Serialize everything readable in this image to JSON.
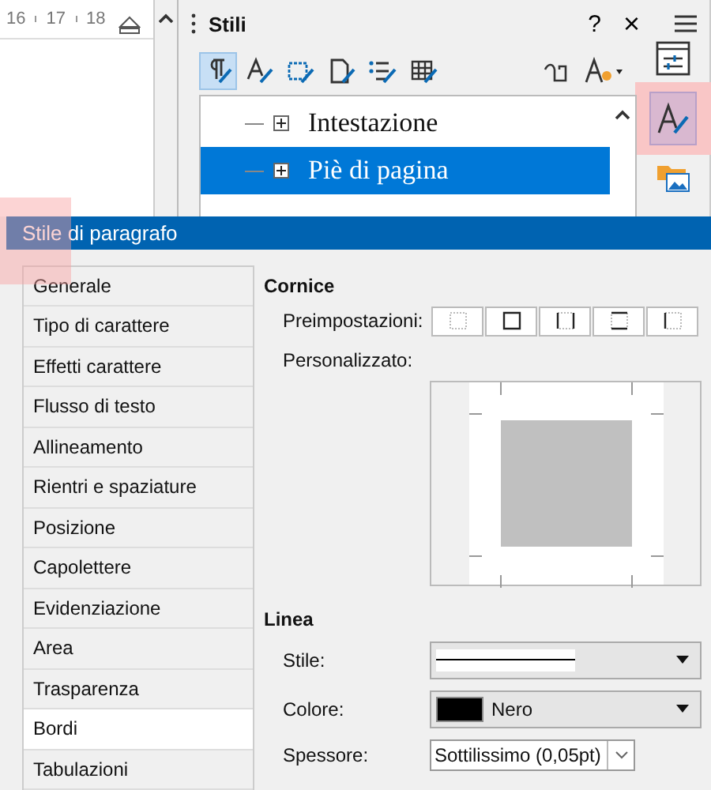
{
  "ruler": {
    "ticks": [
      "16",
      "17",
      "18"
    ]
  },
  "styles_panel": {
    "title": "Stili",
    "help": "?",
    "close": "×",
    "toolbar": [
      {
        "kind": "paragraph",
        "selected": true
      },
      {
        "kind": "character",
        "selected": false
      },
      {
        "kind": "frame",
        "selected": false
      },
      {
        "kind": "page",
        "selected": false
      },
      {
        "kind": "list",
        "selected": false
      },
      {
        "kind": "table",
        "selected": false
      }
    ],
    "tree": [
      {
        "label": "Intestazione",
        "selected": false,
        "expanded": false
      },
      {
        "label": "Piè di pagina",
        "selected": true,
        "expanded": false
      }
    ]
  },
  "dialog": {
    "title": "Stile di paragrafo",
    "tabs": [
      {
        "label": "Generale",
        "selected": false
      },
      {
        "label": "Tipo di carattere",
        "selected": false
      },
      {
        "label": "Effetti carattere",
        "selected": false
      },
      {
        "label": "Flusso di testo",
        "selected": false
      },
      {
        "label": "Allineamento",
        "selected": false
      },
      {
        "label": "Rientri e spaziature",
        "selected": false
      },
      {
        "label": "Posizione",
        "selected": false
      },
      {
        "label": "Capolettere",
        "selected": false
      },
      {
        "label": "Evidenziazione",
        "selected": false
      },
      {
        "label": "Area",
        "selected": false
      },
      {
        "label": "Trasparenza",
        "selected": false
      },
      {
        "label": "Bordi",
        "selected": true
      },
      {
        "label": "Tabulazioni",
        "selected": false
      }
    ],
    "frame": {
      "heading": "Cornice",
      "presets_label": "Preimpostazioni:",
      "custom_label": "Personalizzato:",
      "presets": [
        {
          "kind": "none"
        },
        {
          "kind": "box"
        },
        {
          "kind": "left-right"
        },
        {
          "kind": "top-bottom"
        },
        {
          "kind": "left"
        }
      ]
    },
    "line": {
      "heading": "Linea",
      "style_label": "Stile:",
      "color_label": "Colore:",
      "color_value": "Nero",
      "color": "#000000",
      "width_label": "Spessore:",
      "width_value": "Sottilissimo (0,05pt)"
    }
  }
}
